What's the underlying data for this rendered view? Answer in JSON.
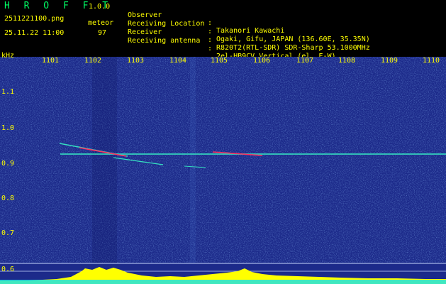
{
  "header": {
    "app_logo": "H R O F F T",
    "app_version": "1.0.0",
    "file_name": "2511221100.png",
    "timestamp": "25.11.22 11:00",
    "meteor_label": "meteor",
    "meteor_count": "97",
    "info": [
      {
        "label": "Observer",
        "value": "Takanori Kawachi"
      },
      {
        "label": "Receiving Location",
        "value": "Ogaki, Gifu, JAPAN (136.60E, 35.35N)"
      },
      {
        "label": "Receiver",
        "value": "R820T2(RTL-SDR) SDR-Sharp 53.1000MHz"
      },
      {
        "label": "Receiving antenna",
        "value": "2el-HB9CV Vertical (el. E-W)"
      }
    ]
  },
  "spectrogram": {
    "y_unit": "kHz",
    "time_ticks": [
      "1101",
      "1102",
      "1103",
      "1104",
      "1105",
      "1106",
      "1107",
      "1108",
      "1109",
      "1110"
    ],
    "khz_ticks": [
      "1.1",
      "1.0",
      "0.9",
      "0.8",
      "0.7",
      "0.6"
    ],
    "colors": {
      "background": "#1c2a8a",
      "noise": "#3a6ad0",
      "trace": "#35e0c0",
      "meteor": "#ff3060",
      "level": "#ffff00",
      "baseline": "#00e0ff"
    }
  }
}
